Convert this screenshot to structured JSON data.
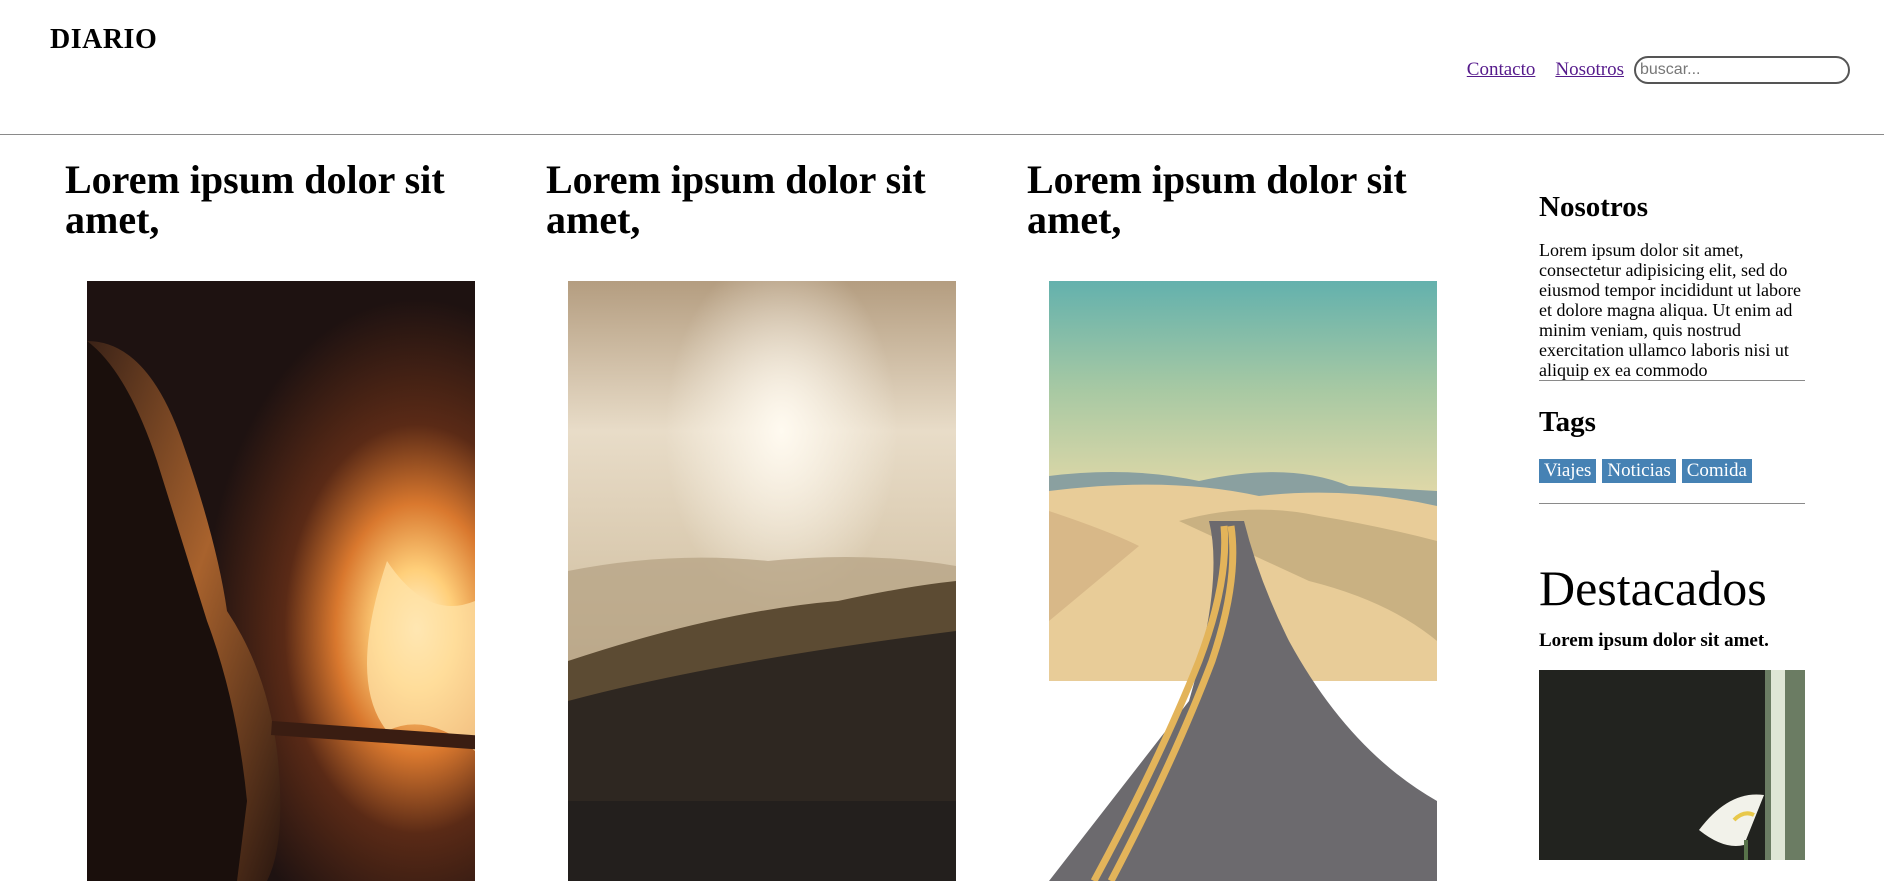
{
  "header": {
    "logo": "DIARIO",
    "nav": [
      {
        "label": "Contacto"
      },
      {
        "label": "Nosotros"
      }
    ],
    "search": {
      "placeholder": "buscar..."
    }
  },
  "articles": [
    {
      "title": "Lorem ipsum dolor sit amet,",
      "image": "bonfire-girl-photo"
    },
    {
      "title": "Lorem ipsum dolor sit amet,",
      "image": "sunset-mountains-photo"
    },
    {
      "title": "Lorem ipsum dolor sit amet,",
      "image": "desert-road-photo"
    }
  ],
  "sidebar": {
    "about": {
      "title": "Nosotros",
      "text": "Lorem ipsum dolor sit amet, consectetur adipisicing elit, sed do eiusmod tempor incididunt ut labore et dolore magna aliqua. Ut enim ad minim veniam, quis nostrud exercitation ullamco laboris nisi ut aliquip ex ea commodo"
    },
    "tags": {
      "title": "Tags",
      "items": [
        "Viajes",
        "Noticias",
        "Comida"
      ]
    },
    "featured": {
      "title": "Destacados",
      "headline": "Lorem ipsum dolor sit amet.",
      "image": "calla-lily-photo"
    }
  },
  "colors": {
    "link": "#551a8b",
    "tag_background": "#4682b4",
    "divider": "#8a8a8a"
  }
}
